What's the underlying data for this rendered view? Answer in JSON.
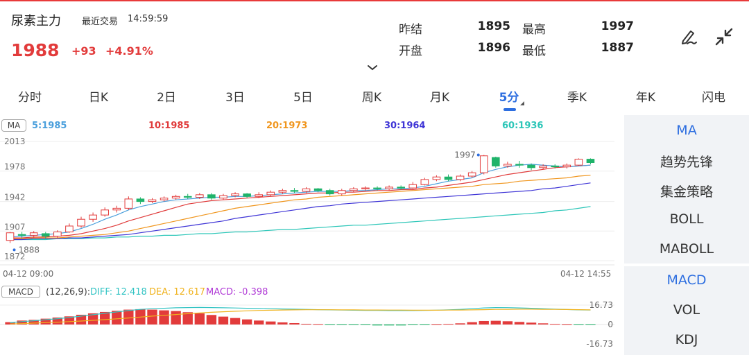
{
  "header": {
    "title": "尿素主力",
    "status": "最近交易",
    "time": "14:59:59",
    "price": "1988",
    "change": "+93",
    "change_pct": "+4.91%"
  },
  "stats": {
    "prev_settle_label": "昨结",
    "prev_settle": "1895",
    "high_label": "最高",
    "high": "1997",
    "open_label": "开盘",
    "open": "1896",
    "low_label": "最低",
    "low": "1887"
  },
  "icons": {
    "draw": "pen-draw-icon",
    "collapse": "collapse-arrows-icon",
    "chevron": "chevron-down-icon"
  },
  "tabs": [
    {
      "label": "分时"
    },
    {
      "label": "日K"
    },
    {
      "label": "2日"
    },
    {
      "label": "3日"
    },
    {
      "label": "5日"
    },
    {
      "label": "周K"
    },
    {
      "label": "月K"
    },
    {
      "label": "5分"
    },
    {
      "label": "季K"
    },
    {
      "label": "年K"
    },
    {
      "label": "闪电"
    }
  ],
  "active_tab": "5分",
  "ma_legend": {
    "label": "MA",
    "ma5": "5:1985",
    "ma10": "10:1985",
    "ma20": "20:1973",
    "ma30": "30:1964",
    "ma60": "60:1936"
  },
  "colors": {
    "up": "#e23b3b",
    "down": "#1fb36a",
    "ma5": "#4a9fdc",
    "ma10": "#e03a3a",
    "ma20": "#f0961e",
    "ma30": "#3f35d6",
    "ma60": "#2cc6b8",
    "accent": "#2d6ee0",
    "diff": "#34c4c4",
    "dea": "#f0b31e",
    "macd": "#b03ad6"
  },
  "chart_data": {
    "type": "candlestick",
    "yaxis_ticks": [
      "2013",
      "1978",
      "1942",
      "1907",
      "1872"
    ],
    "ylim": [
      1872,
      2013
    ],
    "x_start": "04-12 09:00",
    "x_end": "04-12 14:55",
    "high_marker": "1997",
    "low_marker": "1888",
    "candles": [
      [
        1896,
        1905,
        1893,
        1906
      ],
      [
        1903,
        1902,
        1898,
        1906
      ],
      [
        1902,
        1905,
        1899,
        1907
      ],
      [
        1904,
        1901,
        1898,
        1906
      ],
      [
        1901,
        1906,
        1899,
        1908
      ],
      [
        1906,
        1913,
        1905,
        1916
      ],
      [
        1913,
        1921,
        1911,
        1924
      ],
      [
        1921,
        1926,
        1918,
        1929
      ],
      [
        1926,
        1932,
        1924,
        1935
      ],
      [
        1932,
        1934,
        1929,
        1937
      ],
      [
        1934,
        1945,
        1932,
        1948
      ],
      [
        1945,
        1942,
        1939,
        1947
      ],
      [
        1942,
        1944,
        1940,
        1946
      ],
      [
        1944,
        1946,
        1942,
        1948
      ],
      [
        1946,
        1948,
        1944,
        1950
      ],
      [
        1948,
        1947,
        1945,
        1951
      ],
      [
        1947,
        1950,
        1945,
        1952
      ],
      [
        1950,
        1946,
        1944,
        1952
      ],
      [
        1946,
        1949,
        1944,
        1951
      ],
      [
        1949,
        1951,
        1947,
        1953
      ],
      [
        1951,
        1948,
        1946,
        1952
      ],
      [
        1948,
        1950,
        1946,
        1953
      ],
      [
        1950,
        1953,
        1948,
        1955
      ],
      [
        1953,
        1955,
        1951,
        1957
      ],
      [
        1955,
        1954,
        1952,
        1958
      ],
      [
        1954,
        1957,
        1952,
        1959
      ],
      [
        1957,
        1955,
        1953,
        1958
      ],
      [
        1955,
        1951,
        1949,
        1957
      ],
      [
        1951,
        1955,
        1949,
        1957
      ],
      [
        1955,
        1957,
        1953,
        1959
      ],
      [
        1957,
        1958,
        1955,
        1960
      ],
      [
        1958,
        1957,
        1955,
        1960
      ],
      [
        1957,
        1959,
        1955,
        1961
      ],
      [
        1959,
        1958,
        1956,
        1961
      ],
      [
        1958,
        1962,
        1957,
        1965
      ],
      [
        1962,
        1968,
        1961,
        1970
      ],
      [
        1968,
        1971,
        1966,
        1973
      ],
      [
        1971,
        1968,
        1966,
        1974
      ],
      [
        1968,
        1972,
        1966,
        1974
      ],
      [
        1972,
        1976,
        1970,
        1978
      ],
      [
        1976,
        1996,
        1974,
        1997
      ],
      [
        1994,
        1984,
        1982,
        1995
      ],
      [
        1984,
        1986,
        1982,
        1989
      ],
      [
        1986,
        1985,
        1982,
        1990
      ],
      [
        1985,
        1982,
        1979,
        1987
      ],
      [
        1982,
        1984,
        1980,
        1986
      ],
      [
        1984,
        1983,
        1981,
        1986
      ],
      [
        1983,
        1985,
        1981,
        1987
      ],
      [
        1985,
        1992,
        1984,
        1993
      ],
      [
        1992,
        1988,
        1986,
        1993
      ]
    ],
    "ma_series": {
      "ma5": [
        1900,
        1901,
        1902,
        1903,
        1904,
        1906,
        1910,
        1915,
        1921,
        1926,
        1932,
        1936,
        1939,
        1942,
        1944,
        1945,
        1946,
        1947,
        1947,
        1948,
        1948,
        1949,
        1950,
        1951,
        1952,
        1953,
        1954,
        1954,
        1954,
        1955,
        1955,
        1956,
        1957,
        1957,
        1958,
        1960,
        1963,
        1966,
        1968,
        1970,
        1976,
        1980,
        1983,
        1985,
        1986,
        1985,
        1984,
        1983,
        1984,
        1985
      ],
      "ma10": [
        1899,
        1899,
        1900,
        1900,
        1901,
        1902,
        1904,
        1907,
        1910,
        1914,
        1919,
        1923,
        1927,
        1931,
        1935,
        1939,
        1941,
        1943,
        1944,
        1945,
        1946,
        1947,
        1948,
        1949,
        1950,
        1951,
        1952,
        1952,
        1953,
        1953,
        1954,
        1955,
        1955,
        1956,
        1956,
        1958,
        1959,
        1961,
        1963,
        1965,
        1968,
        1971,
        1974,
        1976,
        1978,
        1980,
        1982,
        1983,
        1984,
        1985
      ],
      "ma20": [
        1898,
        1898,
        1899,
        1899,
        1899,
        1900,
        1901,
        1902,
        1903,
        1905,
        1907,
        1910,
        1913,
        1916,
        1919,
        1922,
        1925,
        1928,
        1931,
        1934,
        1936,
        1938,
        1940,
        1942,
        1944,
        1945,
        1947,
        1948,
        1949,
        1950,
        1951,
        1952,
        1953,
        1954,
        1955,
        1956,
        1957,
        1958,
        1959,
        1960,
        1962,
        1963,
        1964,
        1966,
        1967,
        1968,
        1969,
        1970,
        1972,
        1973
      ],
      "ma30": [
        1897,
        1897,
        1898,
        1898,
        1898,
        1899,
        1899,
        1900,
        1901,
        1902,
        1903,
        1905,
        1907,
        1909,
        1911,
        1913,
        1915,
        1917,
        1919,
        1922,
        1924,
        1926,
        1928,
        1930,
        1932,
        1934,
        1936,
        1937,
        1939,
        1940,
        1941,
        1942,
        1943,
        1944,
        1945,
        1946,
        1947,
        1948,
        1949,
        1950,
        1951,
        1952,
        1953,
        1954,
        1955,
        1957,
        1958,
        1960,
        1962,
        1964
      ],
      "ma60": [
        1897,
        1897,
        1897,
        1897,
        1898,
        1898,
        1898,
        1899,
        1899,
        1900,
        1900,
        1901,
        1901,
        1902,
        1902,
        1903,
        1904,
        1904,
        1905,
        1906,
        1906,
        1907,
        1908,
        1909,
        1909,
        1910,
        1911,
        1912,
        1913,
        1914,
        1914,
        1915,
        1916,
        1917,
        1918,
        1919,
        1920,
        1921,
        1922,
        1923,
        1924,
        1925,
        1926,
        1927,
        1928,
        1929,
        1931,
        1932,
        1934,
        1936
      ]
    }
  },
  "macd": {
    "label": "MACD",
    "params": "(12,26,9):",
    "diff": "DIFF: 12.418",
    "dea": "DEA: 12.617",
    "macd": "MACD: -0.398",
    "ticks": [
      "16.73",
      "0",
      "-16.73"
    ],
    "range": [
      -16.73,
      16.73
    ],
    "diff_series": [
      1.5,
      2.5,
      3.2,
      4.1,
      5.0,
      6.0,
      7.2,
      8.4,
      9.6,
      10.8,
      12.0,
      13.0,
      13.6,
      14.0,
      14.4,
      14.6,
      14.7,
      14.6,
      14.4,
      14.2,
      14.0,
      13.8,
      13.6,
      13.4,
      13.2,
      13.0,
      12.8,
      12.6,
      12.4,
      12.3,
      12.2,
      12.1,
      12.0,
      12.0,
      12.0,
      12.1,
      12.3,
      12.6,
      13.0,
      13.6,
      14.3,
      14.6,
      14.5,
      14.3,
      14.0,
      13.6,
      13.2,
      12.9,
      12.6,
      12.4
    ],
    "dea_series": [
      0.5,
      0.8,
      1.2,
      1.6,
      2.0,
      2.5,
      3.0,
      3.6,
      4.2,
      4.9,
      5.6,
      6.4,
      7.2,
      7.9,
      8.6,
      9.3,
      9.9,
      10.5,
      11.0,
      11.4,
      11.8,
      12.1,
      12.3,
      12.5,
      12.6,
      12.7,
      12.7,
      12.7,
      12.6,
      12.6,
      12.5,
      12.5,
      12.4,
      12.4,
      12.3,
      12.3,
      12.3,
      12.4,
      12.5,
      12.6,
      12.8,
      13.0,
      13.1,
      13.2,
      13.2,
      13.1,
      13.0,
      12.9,
      12.8,
      12.6
    ],
    "hist_series": [
      2.0,
      3.4,
      4.0,
      5.0,
      6.0,
      7.0,
      8.4,
      9.6,
      10.8,
      11.8,
      12.8,
      13.2,
      12.8,
      12.2,
      11.6,
      10.6,
      9.6,
      8.2,
      6.8,
      5.6,
      4.4,
      3.4,
      2.6,
      1.8,
      1.2,
      0.6,
      0.2,
      -0.2,
      -0.4,
      -0.6,
      -0.6,
      -0.8,
      -0.8,
      -0.8,
      -0.6,
      -0.4,
      0.0,
      0.4,
      1.0,
      2.0,
      3.0,
      3.2,
      2.8,
      2.2,
      1.6,
      1.0,
      0.4,
      0.0,
      -0.4,
      -0.4
    ]
  },
  "right_panel": {
    "main_items": [
      {
        "label": "MA",
        "active": true
      },
      {
        "label": "趋势先锋",
        "active": false
      },
      {
        "label": "集金策略",
        "active": false
      },
      {
        "label": "BOLL",
        "active": false
      },
      {
        "label": "MABOLL",
        "active": false
      }
    ],
    "sub_items": [
      {
        "label": "MACD",
        "active": true
      },
      {
        "label": "VOL",
        "active": false
      },
      {
        "label": "KDJ",
        "active": false
      }
    ]
  }
}
